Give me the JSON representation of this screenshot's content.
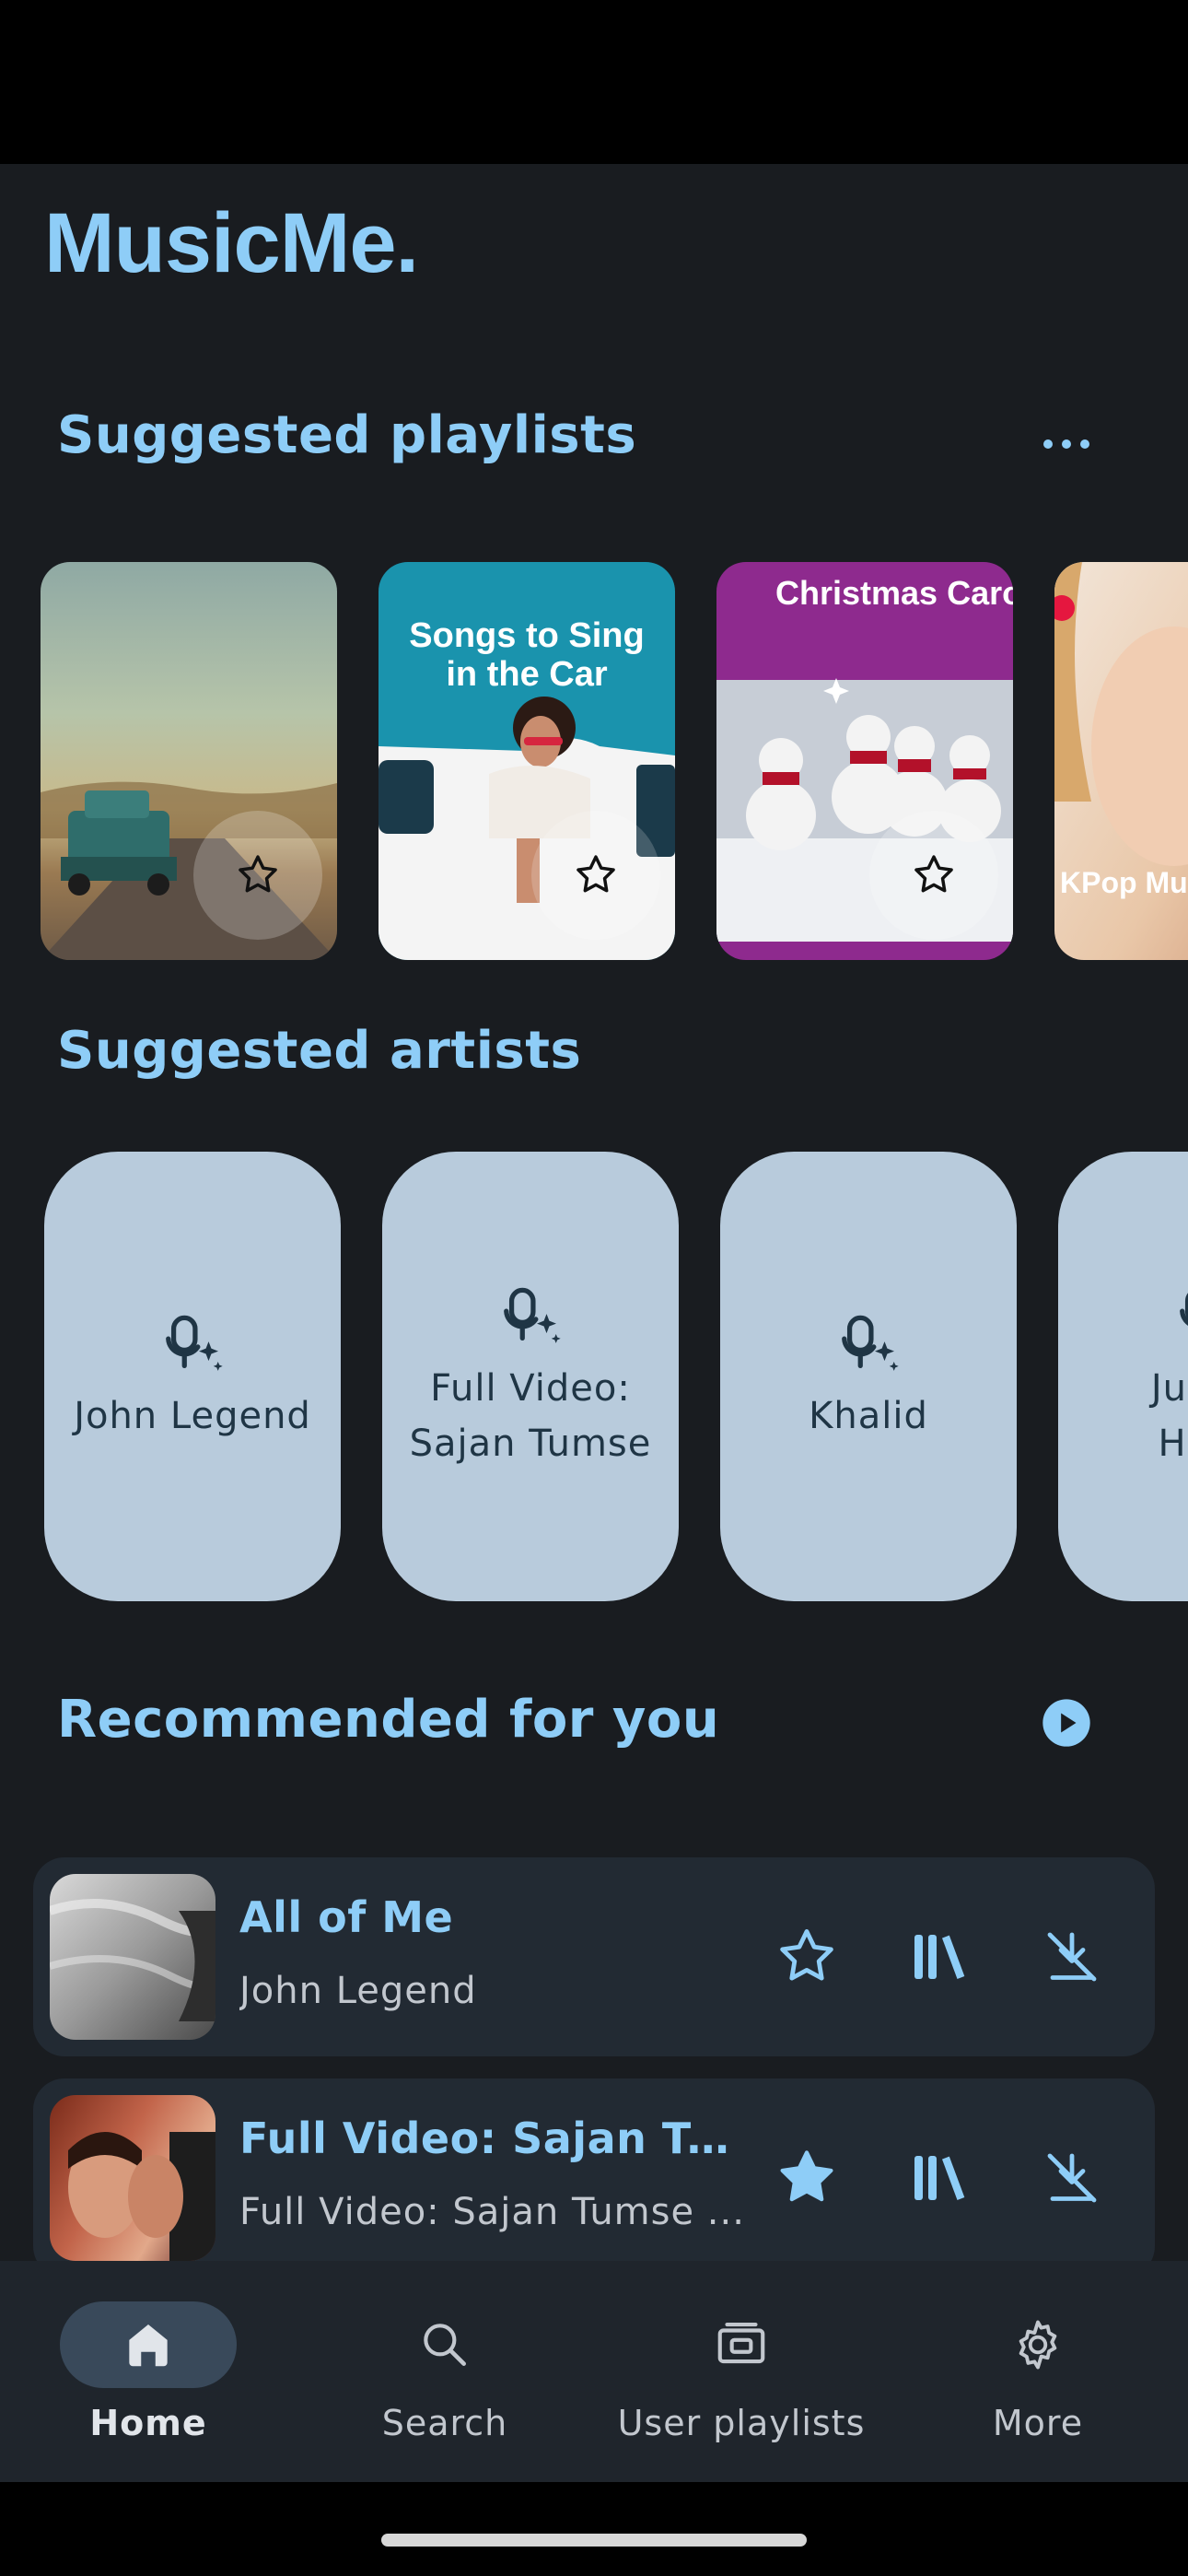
{
  "app": {
    "title": "MusicMe."
  },
  "playlists": {
    "title": "Suggested playlists",
    "more_icon": "more-horizontal-icon",
    "items": [
      {
        "label": "",
        "favorited": false
      },
      {
        "label": "Songs to Sing in the Car",
        "favorited": false
      },
      {
        "label": "Christmas Carols",
        "favorited": false
      },
      {
        "label": "KPop Music Hits",
        "favorited": false
      }
    ]
  },
  "artists": {
    "title": "Suggested artists",
    "items": [
      {
        "name": "John Legend"
      },
      {
        "name": "Full Video: Sajan Tumse"
      },
      {
        "name": "Khalid"
      },
      {
        "name": "Just C HD V"
      }
    ]
  },
  "recommended": {
    "title": "Recommended for you",
    "play_icon": "play-circle-icon",
    "items": [
      {
        "title": "All of Me",
        "artist": "John Legend",
        "favorited": false
      },
      {
        "title": "Full Video: Sajan Tu...",
        "artist": "Full Video: Sajan Tumse ...",
        "favorited": true
      }
    ]
  },
  "nav": {
    "items": [
      {
        "label": "Home",
        "icon": "home-icon",
        "active": true
      },
      {
        "label": "Search",
        "icon": "search-icon",
        "active": false
      },
      {
        "label": "User playlists",
        "icon": "playlist-icon",
        "active": false
      },
      {
        "label": "More",
        "icon": "gear-icon",
        "active": false
      }
    ]
  },
  "colors": {
    "accent": "#8ecdf7",
    "background": "#191c20",
    "card": "#222a33",
    "artist_card": "#b8cbdc",
    "nav_background": "#1f252c",
    "nav_active_pill": "#39495a"
  }
}
